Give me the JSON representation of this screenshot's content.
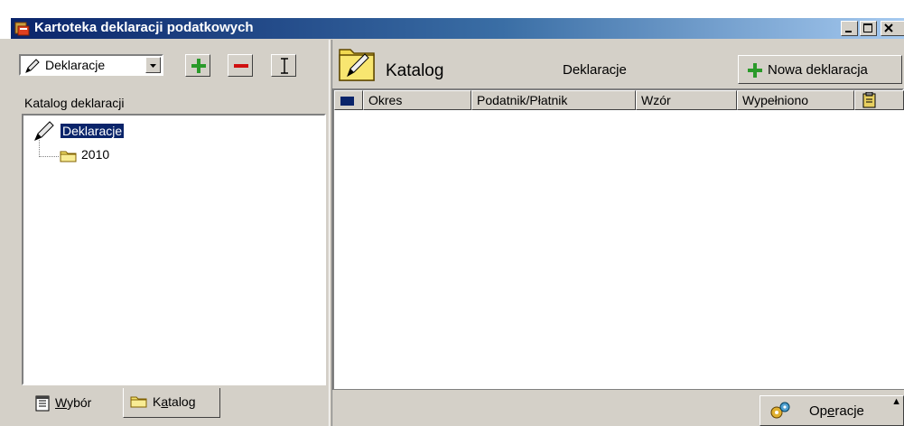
{
  "window": {
    "title": "Kartoteka deklaracji podatkowych",
    "icon": "app-icon",
    "controls": [
      "minimize-icon",
      "maximize-icon",
      "close-icon"
    ]
  },
  "left": {
    "combo_value": "Deklaracje",
    "toolbar": {
      "add_icon": "plus-icon",
      "remove_icon": "minus-icon",
      "cursor_icon": "text-cursor-icon"
    },
    "section_label": "Katalog deklaracji",
    "tree": {
      "root": "Deklaracje",
      "children": [
        "2010"
      ]
    },
    "tabs": [
      {
        "label": "Wybór",
        "underline": "W",
        "rest": "ybór",
        "icon": "notepad-icon"
      },
      {
        "label": "Katalog",
        "pre": "K",
        "underline": "a",
        "rest": "talog",
        "icon": "folder-icon"
      }
    ]
  },
  "right": {
    "katalog_label": "Katalog",
    "center_label": "Deklaracje",
    "new_button": "Nowa deklaracja",
    "columns": [
      "Okres",
      "Podatnik/Płatnik",
      "Wzór",
      "Wypełniono"
    ],
    "operacje": {
      "pre": "Op",
      "underline": "e",
      "rest": "racje"
    }
  },
  "colors": {
    "titlebar_start": "#0a246a",
    "titlebar_end": "#a6caf0",
    "face": "#d4d0c8",
    "selection": "#0a246a"
  }
}
